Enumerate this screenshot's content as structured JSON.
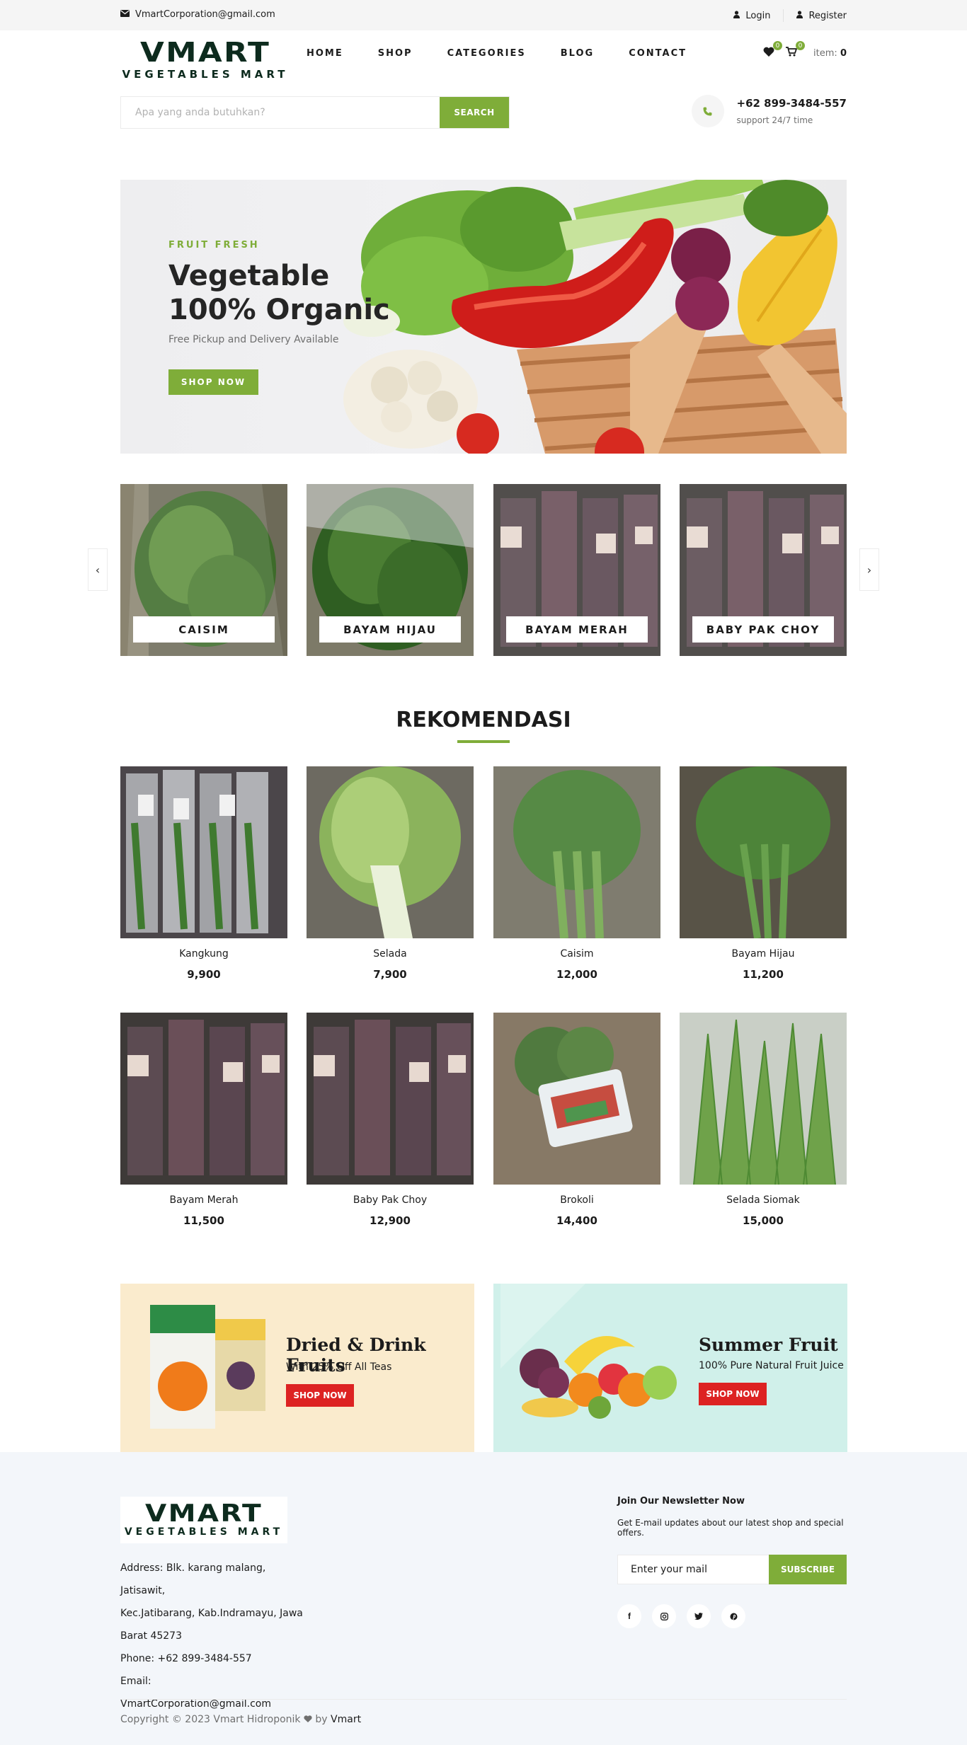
{
  "topbar": {
    "email": "VmartCorporation@gmail.com",
    "login": "Login",
    "register": "Register"
  },
  "brand": {
    "name": "VMART",
    "tagline": "VEGETABLES MART"
  },
  "nav": [
    "HOME",
    "SHOP",
    "CATEGORIES",
    "BLOG",
    "CONTACT"
  ],
  "header": {
    "wishlist_count": "0",
    "cart_count": "0",
    "item_label": "item:",
    "item_total": "0"
  },
  "search": {
    "placeholder": "Apa yang anda butuhkan?",
    "button": "SEARCH"
  },
  "phone": {
    "number": "+62 899-3484-557",
    "support": "support 24/7 time"
  },
  "hero": {
    "tag": "FRUIT FRESH",
    "title_line1": "Vegetable",
    "title_line2": "100% Organic",
    "subtitle": "Free Pickup and Delivery Available",
    "button": "SHOP NOW"
  },
  "categories": [
    {
      "label": "CAISIM"
    },
    {
      "label": "BAYAM HIJAU"
    },
    {
      "label": "BAYAM MERAH"
    },
    {
      "label": "BABY PAK CHOY"
    }
  ],
  "recommend": {
    "title": "REKOMENDASI",
    "products": [
      {
        "name": "Kangkung",
        "price": "9,900"
      },
      {
        "name": "Selada",
        "price": "7,900"
      },
      {
        "name": "Caisim",
        "price": "12,000"
      },
      {
        "name": "Bayam Hijau",
        "price": "11,200"
      },
      {
        "name": "Bayam Merah",
        "price": "11,500"
      },
      {
        "name": "Baby Pak Choy",
        "price": "12,900"
      },
      {
        "name": "Brokoli",
        "price": "14,400"
      },
      {
        "name": "Selada Siomak",
        "price": "15,000"
      }
    ]
  },
  "banners": [
    {
      "title": "Dried & Drink Fruits",
      "subtitle": "With 25% Off All Teas",
      "button": "SHOP NOW",
      "bg": "#faebcd"
    },
    {
      "title": "Summer Fruit",
      "subtitle": "100% Pure Natural Fruit Juice",
      "button": "SHOP NOW",
      "bg": "#d0f0ea"
    }
  ],
  "footer": {
    "address_1": "Address: Blk. karang malang, Jatisawit,",
    "address_2": "Kec.Jatibarang, Kab.Indramayu, Jawa",
    "address_3": "Barat 45273",
    "phone": "Phone: +62 899-3484-557",
    "email": "Email: VmartCorporation@gmail.com",
    "newsletter_title": "Join Our Newsletter Now",
    "newsletter_text": "Get E-mail updates about our latest shop and special offers.",
    "newsletter_placeholder": "Enter your mail",
    "subscribe": "SUBSCRIBE",
    "copyright": "Copyright © 2023 Vmart Hidroponik",
    "by": "by",
    "by_name": "Vmart"
  },
  "colors": {
    "accent": "#7fad39",
    "danger": "#dd2222",
    "topbar": "#f5f5f5",
    "footer": "#f3f6fa"
  },
  "icons": [
    "envelope-icon",
    "user-icon",
    "heart-icon",
    "shopping-bag-icon",
    "phone-icon",
    "chevron-left-icon",
    "chevron-right-icon",
    "facebook-icon",
    "instagram-icon",
    "twitter-icon",
    "pinterest-icon",
    "heart-icon"
  ]
}
